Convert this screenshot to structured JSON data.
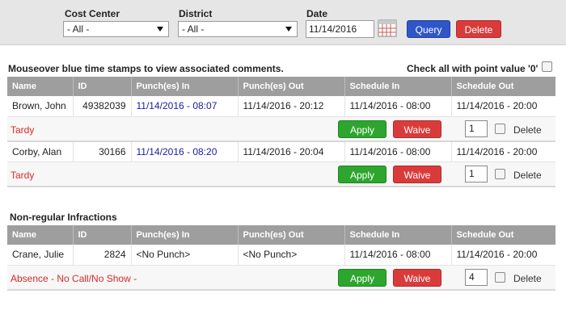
{
  "filters": {
    "cost_center": {
      "label": "Cost Center",
      "value": "- All -"
    },
    "district": {
      "label": "District",
      "value": "- All -"
    },
    "date": {
      "label": "Date",
      "value": "11/14/2016"
    },
    "query_label": "Query",
    "delete_label": "Delete"
  },
  "notes": {
    "mouseover": "Mouseover blue time stamps to view associated comments.",
    "check_all": "Check all with point value '0'"
  },
  "columns": [
    "Name",
    "ID",
    "Punch(es) In",
    "Punch(es) Out",
    "Schedule In",
    "Schedule Out"
  ],
  "tardies": [
    {
      "name": "Brown, John",
      "id": "49382039",
      "punch_in": "11/14/2016 - 08:07",
      "punch_out": "11/14/2016 - 20:12",
      "schedule_in": "11/14/2016 - 08:00",
      "schedule_out": "11/14/2016 - 20:00",
      "status": "Tardy",
      "points": "1"
    },
    {
      "name": "Corby, Alan",
      "id": "30166",
      "punch_in": "11/14/2016 - 08:20",
      "punch_out": "11/14/2016 - 20:04",
      "schedule_in": "11/14/2016 - 08:00",
      "schedule_out": "11/14/2016 - 20:00",
      "status": "Tardy",
      "points": "1"
    }
  ],
  "nonregular": {
    "title": "Non-regular Infractions",
    "rows": [
      {
        "name": "Crane, Julie",
        "id": "2824",
        "punch_in": "<No Punch>",
        "punch_out": "<No Punch>",
        "schedule_in": "11/14/2016 - 08:00",
        "schedule_out": "11/14/2016 - 20:00",
        "status": "Absence - No Call/No Show -",
        "points": "4"
      }
    ]
  },
  "actions": {
    "apply": "Apply",
    "waive": "Waive",
    "delete": "Delete"
  },
  "colors": {
    "accent_blue": "#2f56c9",
    "danger_red": "#d93b3b",
    "apply_green": "#2ea52e",
    "header_gray": "#9e9e9e"
  }
}
